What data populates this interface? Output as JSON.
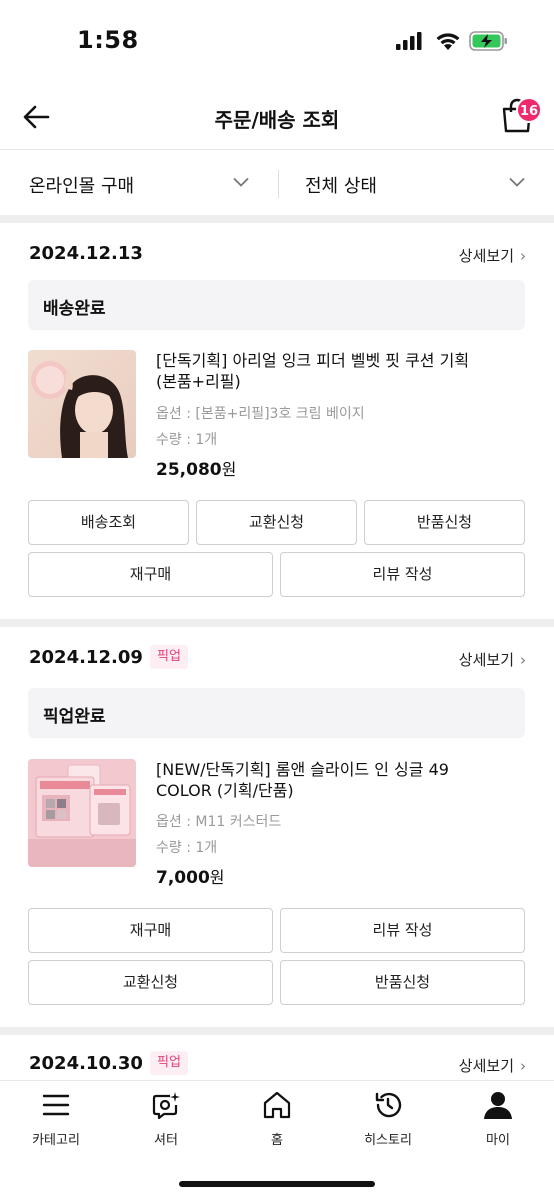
{
  "status_bar": {
    "time": "1:58"
  },
  "header": {
    "title": "주문/배송 조회",
    "cart_count": "16"
  },
  "filters": {
    "channel": "온라인몰 구매",
    "status": "전체 상태"
  },
  "detail_link": "상세보기",
  "orders": [
    {
      "date": "2024.12.13",
      "status": "배송완료",
      "product": {
        "name": "[단독기획] 아리얼 잉크 피더 벨벳 핏 쿠션 기획(본품+리필)",
        "option": "옵션 : [본품+리필]3호 크림 베이지",
        "quantity": "수량 : 1개",
        "price": "25,080",
        "currency": "원"
      },
      "buttons": [
        "배송조회",
        "교환신청",
        "반품신청",
        "재구매",
        "리뷰 작성"
      ]
    },
    {
      "date": "2024.12.09",
      "badge": "픽업",
      "status": "픽업완료",
      "product": {
        "name": "[NEW/단독기획] 롬앤 슬라이드 인 싱글 49 COLOR (기획/단품)",
        "option": "옵션 : M11 커스터드",
        "quantity": "수량 : 1개",
        "price": "7,000",
        "currency": "원"
      },
      "buttons": [
        "재구매",
        "리뷰 작성",
        "교환신청",
        "반품신청"
      ]
    },
    {
      "date": "2024.10.30",
      "badge": "픽업"
    }
  ],
  "bottom_nav": [
    {
      "label": "카테고리",
      "icon": "menu-icon"
    },
    {
      "label": "셔터",
      "icon": "shutter-icon"
    },
    {
      "label": "홈",
      "icon": "home-icon"
    },
    {
      "label": "히스토리",
      "icon": "history-icon"
    },
    {
      "label": "마이",
      "icon": "user-icon"
    }
  ],
  "colors": {
    "accent": "#f0296b",
    "pickup_badge_bg": "#fdeef3",
    "pickup_badge_text": "#e0457b"
  }
}
